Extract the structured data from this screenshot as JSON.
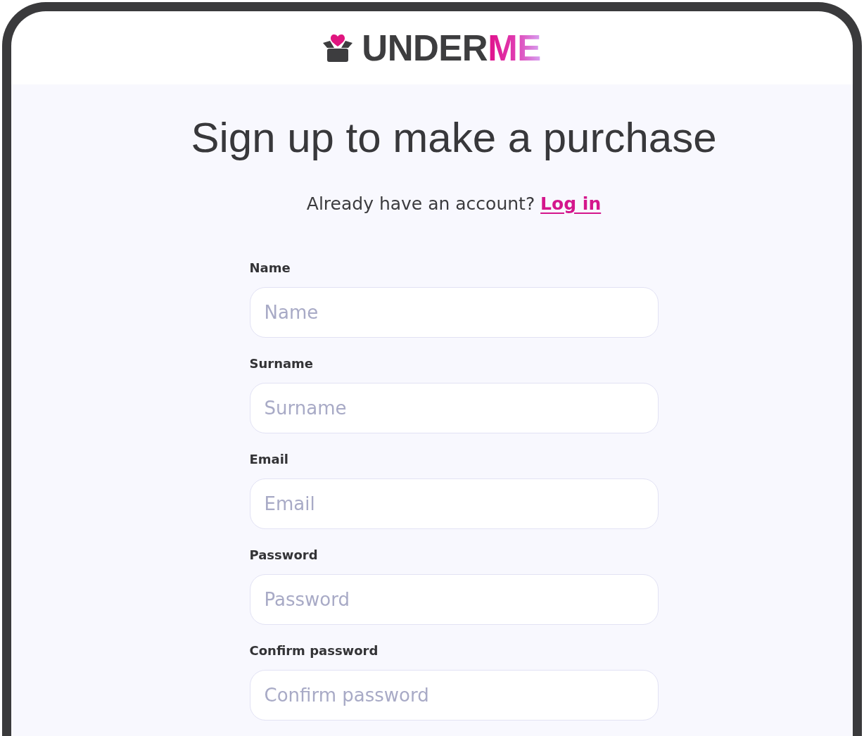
{
  "header": {
    "logo": {
      "text": "UNDER",
      "accent": "ME"
    }
  },
  "title": "Sign up to make a purchase",
  "login_prompt": {
    "text": "Already have an account?",
    "link": "Log in"
  },
  "form": {
    "fields": [
      {
        "label": "Name",
        "placeholder": "Name"
      },
      {
        "label": "Surname",
        "placeholder": "Surname"
      },
      {
        "label": "Email",
        "placeholder": "Email"
      },
      {
        "label": "Password",
        "placeholder": "Password"
      },
      {
        "label": "Confirm password",
        "placeholder": "Confirm password"
      }
    ]
  }
}
